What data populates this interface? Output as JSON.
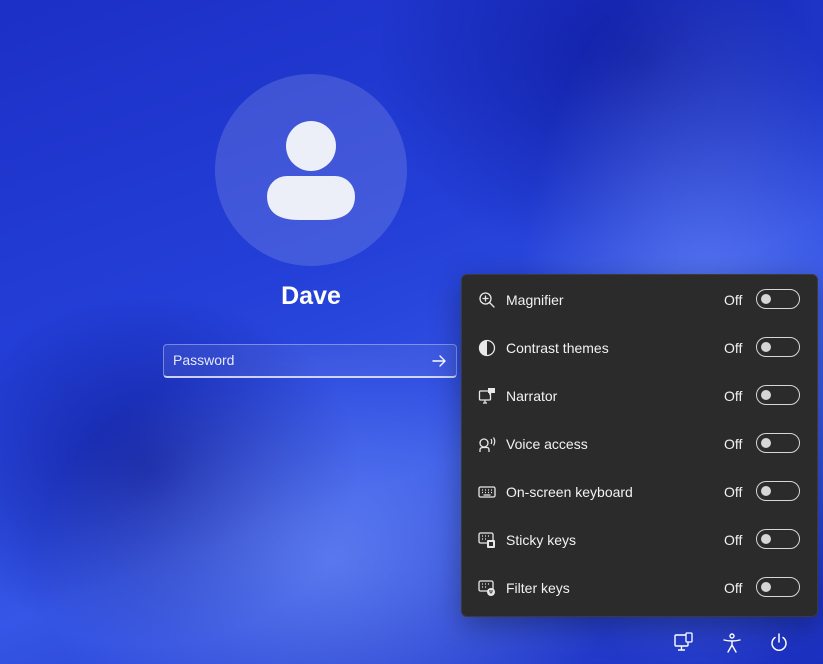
{
  "user": {
    "name": "Dave"
  },
  "password": {
    "placeholder": "Password"
  },
  "accessibility": {
    "items": [
      {
        "label": "Magnifier",
        "state": "Off",
        "icon": "magnifier-icon"
      },
      {
        "label": "Contrast themes",
        "state": "Off",
        "icon": "contrast-icon"
      },
      {
        "label": "Narrator",
        "state": "Off",
        "icon": "narrator-icon"
      },
      {
        "label": "Voice access",
        "state": "Off",
        "icon": "voice-access-icon"
      },
      {
        "label": "On-screen keyboard",
        "state": "Off",
        "icon": "keyboard-icon"
      },
      {
        "label": "Sticky keys",
        "state": "Off",
        "icon": "sticky-keys-icon"
      },
      {
        "label": "Filter keys",
        "state": "Off",
        "icon": "filter-keys-icon"
      }
    ]
  },
  "tray": {
    "icons": [
      "network-icon",
      "accessibility-icon",
      "power-icon"
    ]
  },
  "colors": {
    "panel": "#2b2b2b",
    "toggle": "#d6d6d6",
    "background": "#2440d8"
  }
}
